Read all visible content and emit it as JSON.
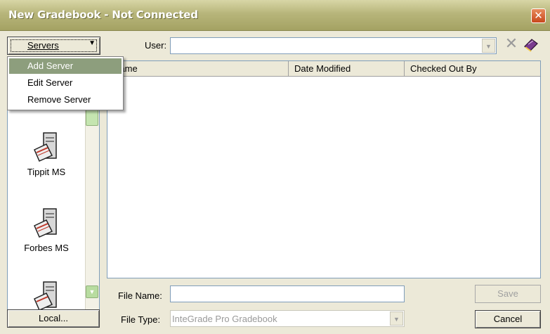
{
  "window": {
    "title": "New Gradebook - Not Connected",
    "close_glyph": "✕"
  },
  "toolbar": {
    "servers_label": "Servers",
    "servers_arrow": "▼",
    "user_label": "User:",
    "user_value": "",
    "delete_icon": "✕"
  },
  "server_menu": {
    "items": [
      {
        "label": "Add Server",
        "highlighted": true
      },
      {
        "label": "Edit Server",
        "highlighted": false
      },
      {
        "label": "Remove Server",
        "highlighted": false
      }
    ]
  },
  "servers": {
    "items": [
      {
        "label": "Tippit MS"
      },
      {
        "label": "Forbes MS"
      },
      {
        "label": ""
      }
    ],
    "scroll_down_glyph": "▼"
  },
  "file_list": {
    "columns": [
      "Name",
      "Date Modified",
      "Checked Out By"
    ],
    "rows": []
  },
  "bottom": {
    "file_name_label": "File Name:",
    "file_name_value": "",
    "file_type_label": "File Type:",
    "file_type_value": "InteGrade Pro Gradebook",
    "save_label": "Save",
    "cancel_label": "Cancel",
    "local_label": "Local..."
  },
  "colors": {
    "title_bar": "#b7b57a",
    "menu_highlight": "#8d9e7d",
    "close_button": "#c8481c"
  }
}
